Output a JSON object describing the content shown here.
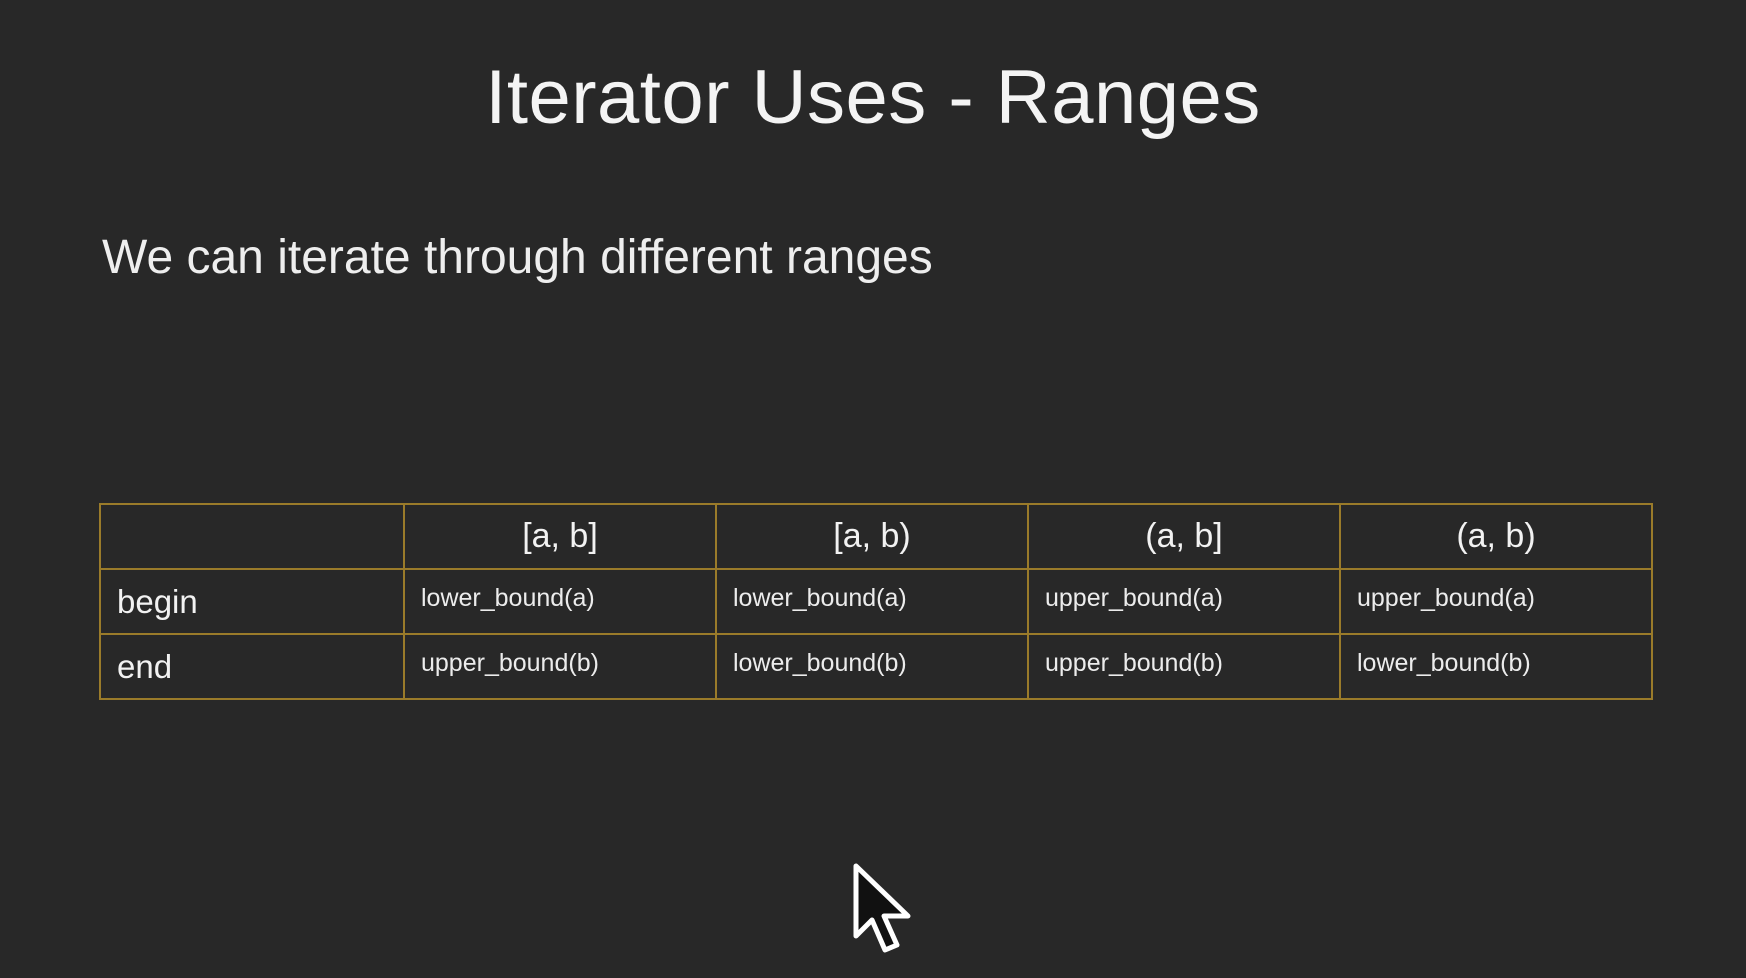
{
  "slide": {
    "title": "Iterator Uses - Ranges",
    "subtitle": "We can iterate through different ranges"
  },
  "table": {
    "corner": "",
    "columns": [
      "[a, b]",
      "[a, b)",
      "(a, b]",
      "(a, b)"
    ],
    "rows": [
      {
        "label": "begin",
        "cells": [
          "lower_bound(a)",
          "lower_bound(a)",
          "upper_bound(a)",
          "upper_bound(a)"
        ]
      },
      {
        "label": "end",
        "cells": [
          "upper_bound(b)",
          "lower_bound(b)",
          "upper_bound(b)",
          "lower_bound(b)"
        ]
      }
    ]
  },
  "colors": {
    "background": "#282828",
    "table_border": "#9a7b2a",
    "text": "#f2f2f2"
  },
  "icons": {
    "cursor": "mouse-pointer-icon"
  }
}
